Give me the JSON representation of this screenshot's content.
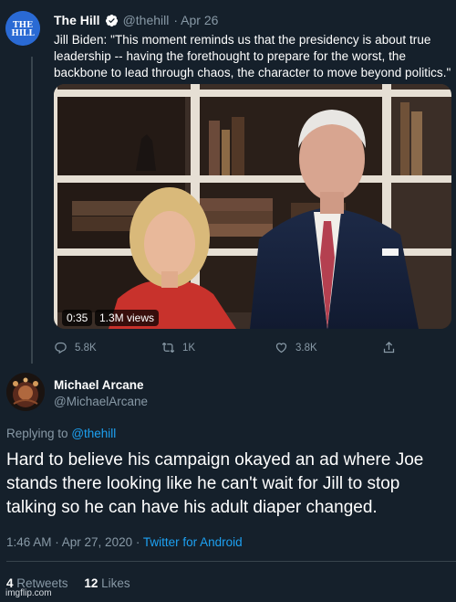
{
  "quoted_tweet": {
    "avatar_text": "THE HILL",
    "author_name": "The Hill",
    "author_handle": "@thehill",
    "date": "· Apr 26",
    "text": "Jill Biden: \"This moment reminds us that the presidency is about true leadership -- having the forethought to prepare for the worst, the backbone to lead through chaos, the character to move beyond politics.\"",
    "video": {
      "duration": "0:35",
      "views": "1.3M views"
    },
    "actions": {
      "replies": "5.8K",
      "retweets": "1K",
      "likes": "3.8K"
    }
  },
  "tweet": {
    "author_name": "Michael Arcane",
    "author_handle": "@MichaelArcane",
    "replying_prefix": "Replying to",
    "replying_handle": "@thehill",
    "text": "Hard to believe his campaign okayed an ad where Joe stands there looking like he can't wait for Jill to stop talking so he can have his adult diaper changed.",
    "timestamp": "1:46 AM · Apr 27, 2020 ·",
    "client": "Twitter for Android",
    "retweets_count": "4",
    "retweets_label": "Retweets",
    "likes_count": "12",
    "likes_label": "Likes"
  },
  "watermark": "imgflip.com",
  "colors": {
    "background": "#15202b",
    "muted": "#8899a6",
    "link": "#1da1f2",
    "divider": "#38444d"
  },
  "icons": [
    "verified-icon",
    "reply-icon",
    "retweet-icon",
    "like-icon",
    "share-icon"
  ]
}
